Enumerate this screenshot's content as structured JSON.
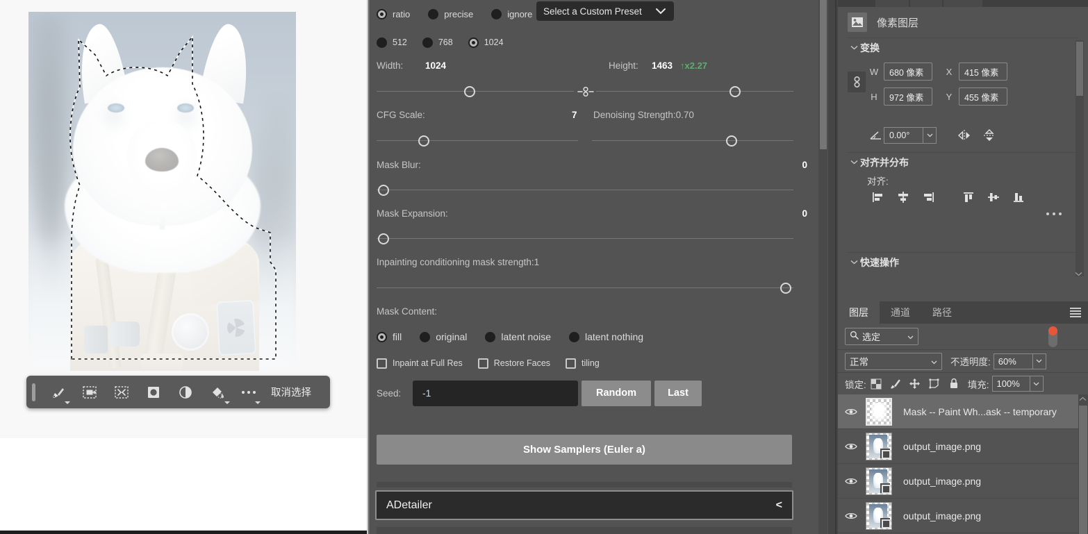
{
  "canvas": {
    "document_description": "white wolf in tactical gear, snowy forest background, selection active",
    "context_bar": {
      "tools": [
        {
          "name": "select-subject-brush-icon",
          "label": "Select Subject"
        },
        {
          "name": "transform-selection-icon",
          "label": "Transform Selection"
        },
        {
          "name": "invert-selection-icon",
          "label": "Invert Selection"
        },
        {
          "name": "mask-selection-icon",
          "label": "Add Mask"
        },
        {
          "name": "adjustment-layer-icon",
          "label": "New Adjustment Layer"
        },
        {
          "name": "fill-selection-icon",
          "label": "Fill Selection"
        },
        {
          "name": "more-options-icon",
          "label": "More options"
        }
      ],
      "deselect_label": "取消选择"
    }
  },
  "sd_panel": {
    "mode_options": [
      {
        "label": "ratio",
        "selected": true
      },
      {
        "label": "precise",
        "selected": false
      },
      {
        "label": "ignore",
        "selected": false
      }
    ],
    "preset": {
      "value": "Select a Custom Preset",
      "chevron": "chevron-down-icon"
    },
    "size_options": [
      {
        "label": "512",
        "selected": false
      },
      {
        "label": "768",
        "selected": false
      },
      {
        "label": "1024",
        "selected": true
      }
    ],
    "dimensions": {
      "width_label": "Width:",
      "width_value": "1024",
      "height_label": "Height:",
      "height_value": "1463",
      "scale_badge": "↑x2.27"
    },
    "cfg": {
      "label": "CFG Scale:",
      "value": "7"
    },
    "denoising": {
      "label": "Denoising Strength:0.70"
    },
    "mask_blur": {
      "label": "Mask Blur:",
      "value": "0"
    },
    "mask_expansion": {
      "label": "Mask Expansion:",
      "value": "0"
    },
    "inpainting_cond": {
      "label": "Inpainting conditioning mask strength:1"
    },
    "mask_content": {
      "label": "Mask Content:",
      "options": [
        {
          "label": "fill",
          "selected": true
        },
        {
          "label": "original",
          "selected": false
        },
        {
          "label": "latent noise",
          "selected": false
        },
        {
          "label": "latent nothing",
          "selected": false
        }
      ]
    },
    "checkboxes": [
      {
        "label": "Inpaint at Full Res",
        "checked": false
      },
      {
        "label": "Restore Faces",
        "checked": false
      },
      {
        "label": "tiling",
        "checked": false
      }
    ],
    "seed": {
      "label": "Seed:",
      "value": "-1",
      "random_label": "Random",
      "last_label": "Last"
    },
    "samplers_button": "Show Samplers (Euler a)",
    "adetailer": {
      "title": "ADetailer",
      "arrow": "<"
    }
  },
  "properties_panel": {
    "layer_type": "像素图层",
    "layer_type_icon": "pixel-layer-icon",
    "transform": {
      "title": "变换",
      "w_key": "W",
      "w_value": "680 像素",
      "x_key": "X",
      "x_value": "415 像素",
      "h_key": "H",
      "h_value": "972 像素",
      "y_key": "Y",
      "y_value": "455 像素",
      "link_icon": "link-aspect-ratio-icon",
      "angle_icon": "angle-icon",
      "angle_value": "0.00°",
      "flip_h_icon": "flip-horizontal-icon",
      "flip_v_icon": "flip-vertical-icon"
    },
    "align": {
      "title": "对齐并分布",
      "subtitle": "对齐:",
      "buttons": [
        {
          "name": "align-left-icon"
        },
        {
          "name": "align-center-horizontal-icon"
        },
        {
          "name": "align-right-icon"
        },
        {
          "name": "align-top-icon"
        },
        {
          "name": "align-center-vertical-icon"
        },
        {
          "name": "align-bottom-icon"
        }
      ],
      "more_icon": "more-align-options-icon"
    },
    "quick_actions": {
      "title": "快速操作"
    }
  },
  "layers_panel": {
    "tabs": [
      {
        "label": "图层",
        "active": true
      },
      {
        "label": "通道",
        "active": false
      },
      {
        "label": "路径",
        "active": false
      }
    ],
    "menu_icon": "panel-menu-icon",
    "filter": {
      "icon": "search-icon",
      "value": "选定",
      "chevron": "chevron-down-icon",
      "toggle_on": true
    },
    "blend_mode": {
      "value": "正常",
      "opacity_label": "不透明度:",
      "opacity_value": "60%"
    },
    "lock": {
      "label": "锁定:",
      "buttons": [
        {
          "name": "lock-transparent-pixels-icon"
        },
        {
          "name": "lock-image-pixels-icon"
        },
        {
          "name": "lock-position-icon"
        },
        {
          "name": "lock-artboard-nesting-icon"
        },
        {
          "name": "lock-all-icon"
        }
      ],
      "fill_label": "填充:",
      "fill_value": "100%"
    },
    "layers": [
      {
        "name": "Mask -- Paint Wh...ask -- temporary",
        "visible": true,
        "selected": true,
        "type": "mask"
      },
      {
        "name": "output_image.png",
        "visible": true,
        "selected": false,
        "type": "image"
      },
      {
        "name": "output_image.png",
        "visible": true,
        "selected": false,
        "type": "image"
      },
      {
        "name": "output_image.png",
        "visible": true,
        "selected": false,
        "type": "image"
      }
    ]
  },
  "colors": {
    "panel_bg": "#535353",
    "field_bg": "#2b2b2b",
    "button_bg": "#8c8c8c",
    "accent_green": "#62ab6e",
    "accent_orange": "#e8563a"
  }
}
